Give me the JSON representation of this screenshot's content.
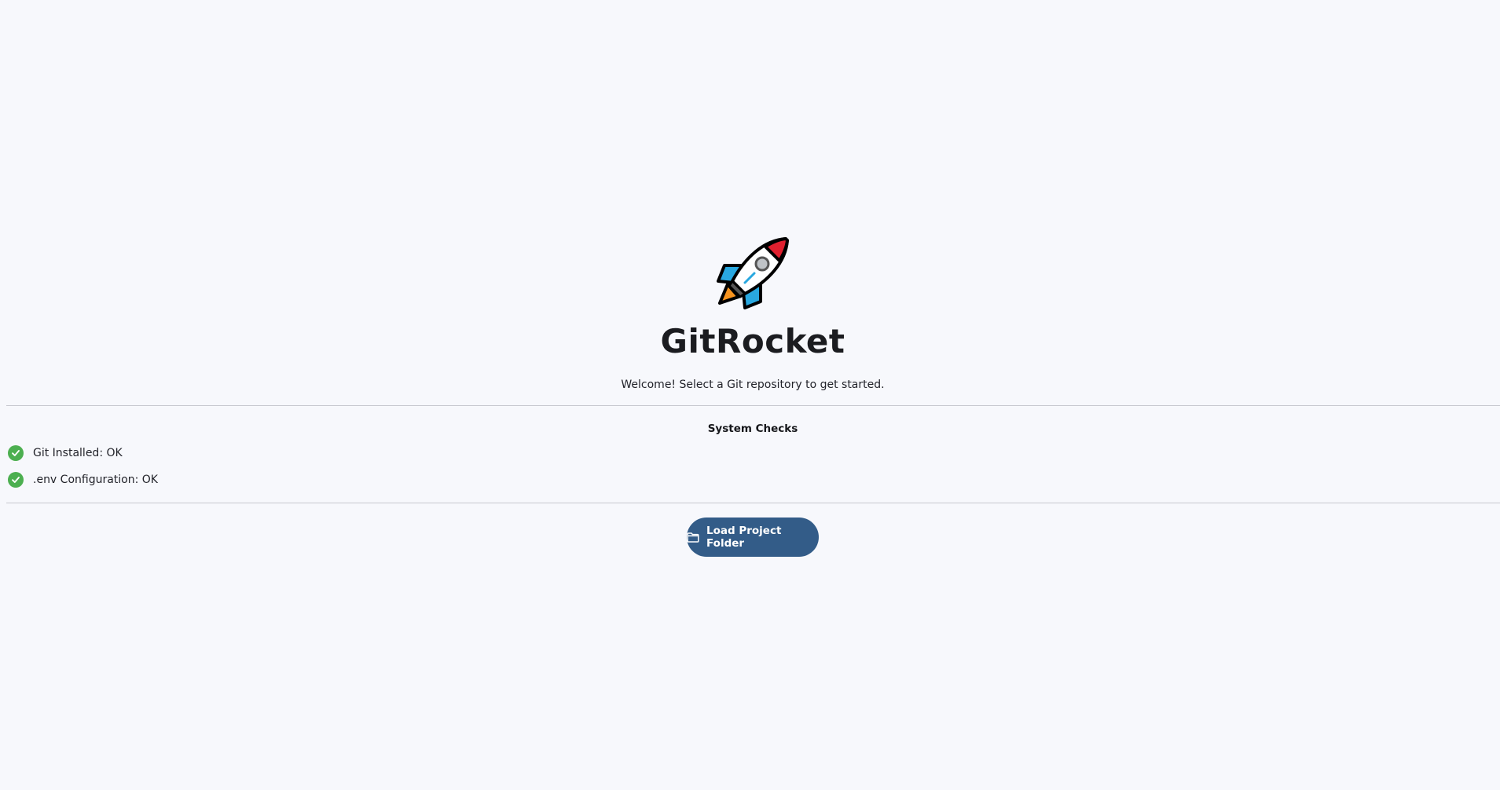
{
  "app": {
    "logo_icon": "rocket-icon",
    "title": "GitRocket",
    "subtitle": "Welcome! Select a Git repository to get started."
  },
  "system_checks": {
    "heading": "System Checks",
    "items": [
      {
        "icon": "check-circle-icon",
        "label": "Git Installed: OK",
        "status": "ok"
      },
      {
        "icon": "check-circle-icon",
        "label": ".env Configuration: OK",
        "status": "ok"
      }
    ]
  },
  "actions": {
    "load_button_icon": "folder-icon",
    "load_button_label": "Load Project Folder"
  },
  "colors": {
    "background": "#f7f8fc",
    "accent": "#335c88",
    "success": "#4caf50"
  }
}
